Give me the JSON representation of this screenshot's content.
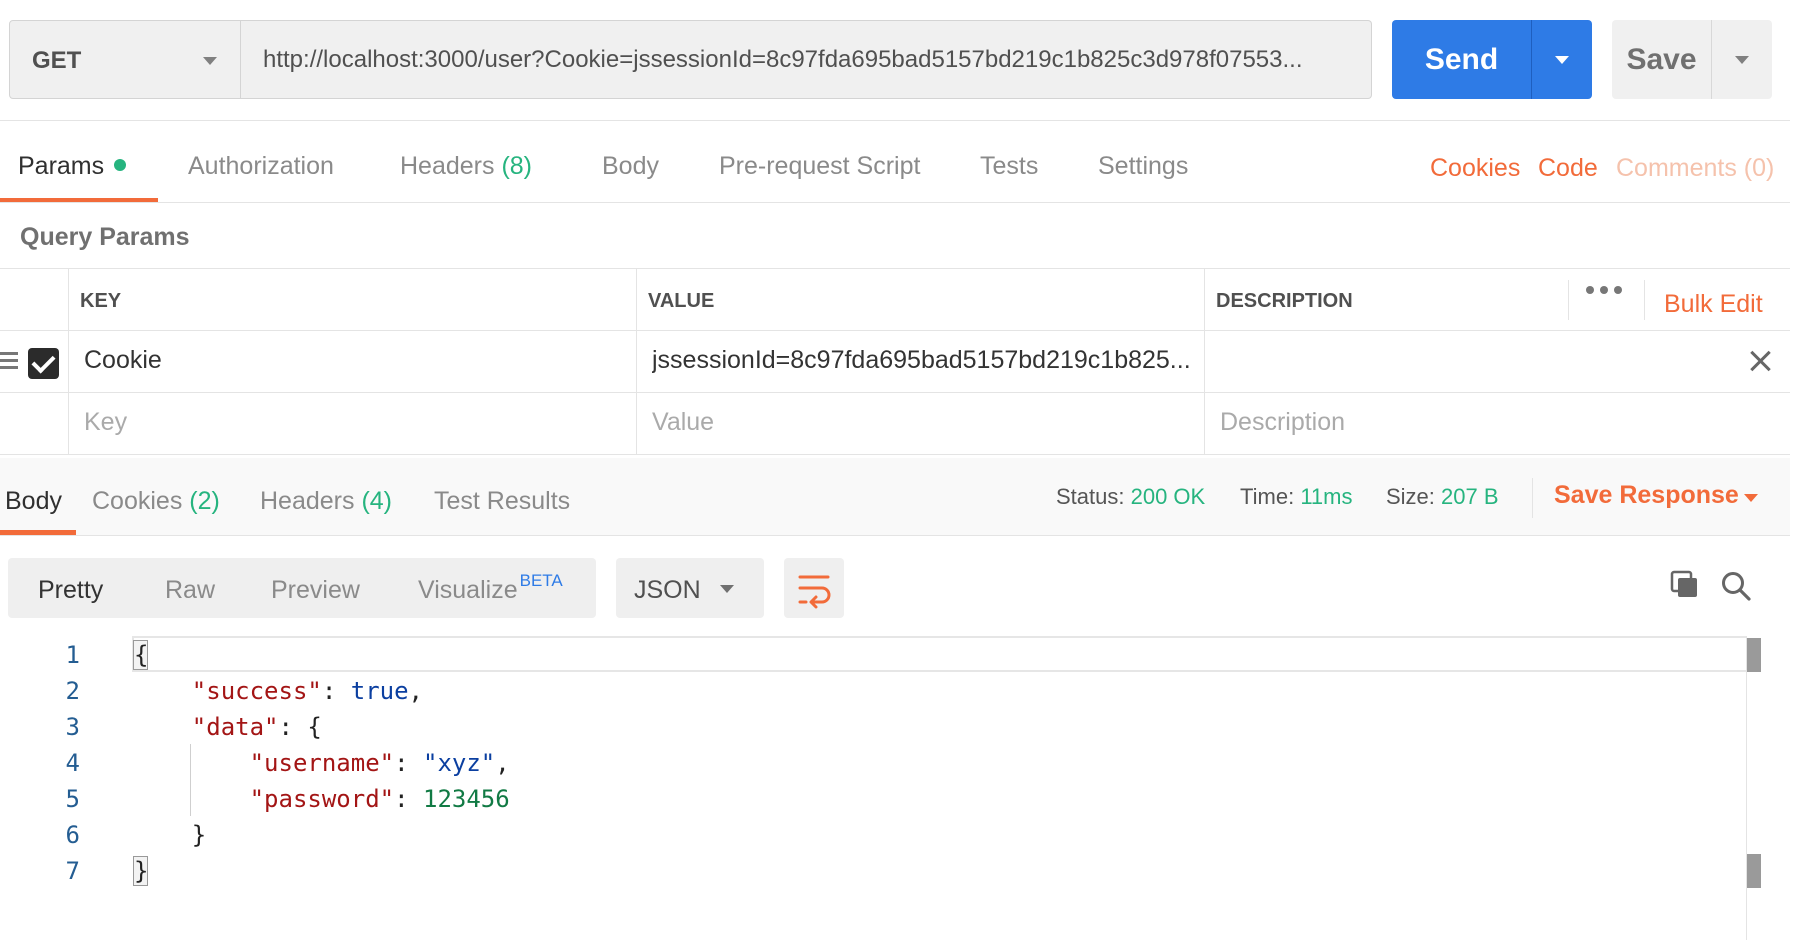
{
  "request": {
    "method": "GET",
    "url": "http://localhost:3000/user?Cookie=jssessionId=8c97fda695bad5157bd219c1b825c3d978f07553...",
    "send_label": "Send",
    "save_label": "Save"
  },
  "request_tabs": {
    "params": "Params",
    "authorization": "Authorization",
    "headers": "Headers",
    "headers_count": "(8)",
    "body": "Body",
    "prerequest": "Pre-request Script",
    "tests": "Tests",
    "settings": "Settings"
  },
  "request_links": {
    "cookies": "Cookies",
    "code": "Code",
    "comments": "Comments (0)"
  },
  "query_params": {
    "title": "Query Params",
    "columns": {
      "key": "KEY",
      "value": "VALUE",
      "description": "DESCRIPTION"
    },
    "bulk_edit": "Bulk Edit",
    "rows": [
      {
        "key": "Cookie",
        "value": "jssessionId=8c97fda695bad5157bd219c1b825...",
        "description": "",
        "checked": true
      }
    ],
    "placeholders": {
      "key": "Key",
      "value": "Value",
      "description": "Description"
    }
  },
  "response_tabs": {
    "body": "Body",
    "cookies": "Cookies",
    "cookies_count": "(2)",
    "headers": "Headers",
    "headers_count": "(4)",
    "test_results": "Test Results"
  },
  "response_meta": {
    "status_label": "Status:",
    "status_value": "200 OK",
    "time_label": "Time:",
    "time_value": "11ms",
    "size_label": "Size:",
    "size_value": "207 B",
    "save_response": "Save Response"
  },
  "view_modes": {
    "pretty": "Pretty",
    "raw": "Raw",
    "preview": "Preview",
    "visualize": "Visualize",
    "beta": "BETA",
    "format": "JSON"
  },
  "editor": {
    "line_numbers": [
      "1",
      "2",
      "3",
      "4",
      "5",
      "6",
      "7"
    ],
    "tokens": {
      "open_brace": "{",
      "success_key": "\"success\"",
      "colon_sep": ": ",
      "success_value": "true",
      "comma": ",",
      "data_key": "\"data\"",
      "data_open": "{",
      "username_key": "\"username\"",
      "username_value": "\"xyz\"",
      "password_key": "\"password\"",
      "password_value": "123456",
      "inner_close": "}",
      "close_brace": "}"
    }
  },
  "icons": {
    "method_caret": "chevron-down-icon",
    "send_caret": "chevron-down-icon",
    "save_caret": "chevron-down-icon",
    "drag": "drag-handle-icon",
    "checkbox": "checkbox-checked-icon",
    "more": "more-horizontal-icon",
    "delete": "close-icon",
    "wrap": "word-wrap-icon",
    "copy": "copy-icon",
    "search": "search-icon"
  },
  "colors": {
    "accent_orange": "#f26b3a",
    "send_blue": "#2e7be6",
    "success_green": "#26b47f"
  }
}
